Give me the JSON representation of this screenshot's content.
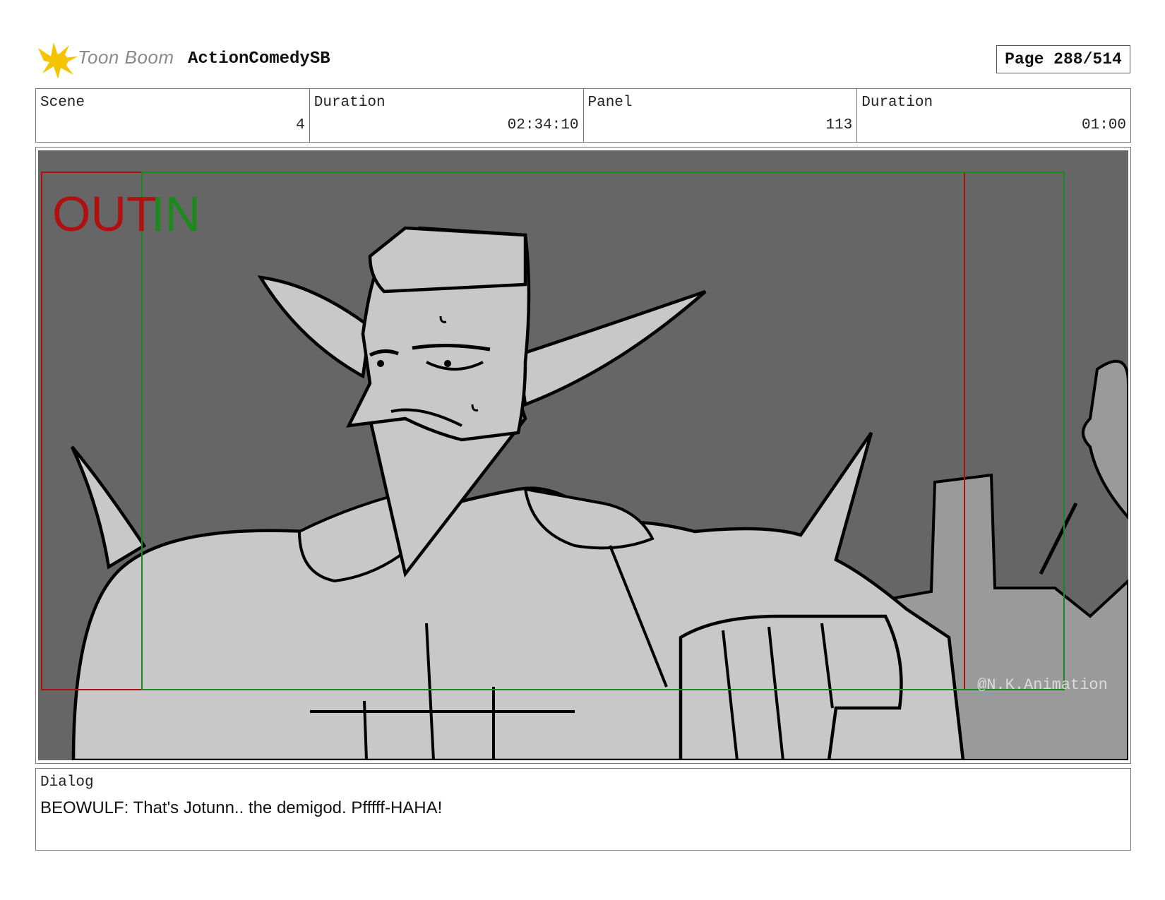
{
  "header": {
    "brand": "Toon Boom",
    "project": "ActionComedySB",
    "page": "Page 288/514"
  },
  "info": {
    "scene_label": "Scene",
    "scene_value": "4",
    "scene_duration_label": "Duration",
    "scene_duration_value": "02:34:10",
    "panel_label": "Panel",
    "panel_value": "113",
    "panel_duration_label": "Duration",
    "panel_duration_value": "01:00"
  },
  "panel_art": {
    "out_label": "OUT",
    "in_label": "IN",
    "watermark": "@N.K.Animation",
    "colors": {
      "background": "#666666",
      "figure": "#c8c8c8",
      "out_frame": "#b01010",
      "in_frame": "#1a8a1a"
    }
  },
  "dialog": {
    "label": "Dialog",
    "text": "BEOWULF: That's Jotunn.. the demigod. Pfffff-HAHA!"
  }
}
